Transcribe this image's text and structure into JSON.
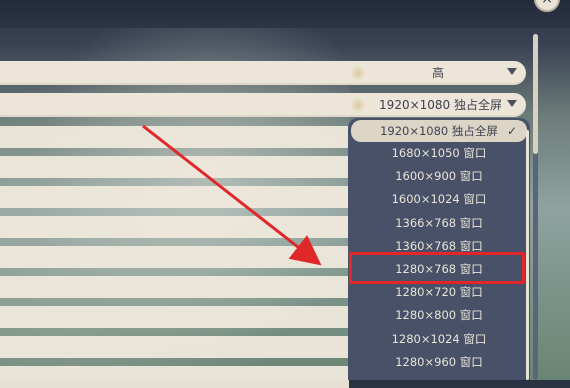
{
  "close_button": {
    "label": "×"
  },
  "settings": {
    "rows": [
      {
        "value": "高"
      },
      {
        "value": "1920×1080 独占全屏"
      }
    ]
  },
  "resolution_dropdown": {
    "options": [
      {
        "label": "1920×1080 独占全屏",
        "selected": true
      },
      {
        "label": "1680×1050 窗口"
      },
      {
        "label": "1600×900 窗口"
      },
      {
        "label": "1600×1024 窗口"
      },
      {
        "label": "1366×768 窗口"
      },
      {
        "label": "1360×768 窗口"
      },
      {
        "label": "1280×768 窗口"
      },
      {
        "label": "1280×720 窗口"
      },
      {
        "label": "1280×800 窗口"
      },
      {
        "label": "1280×1024 窗口"
      },
      {
        "label": "1280×960 窗口"
      }
    ],
    "checkmark": "✓"
  },
  "annotation": {
    "color": "#e0282b"
  }
}
